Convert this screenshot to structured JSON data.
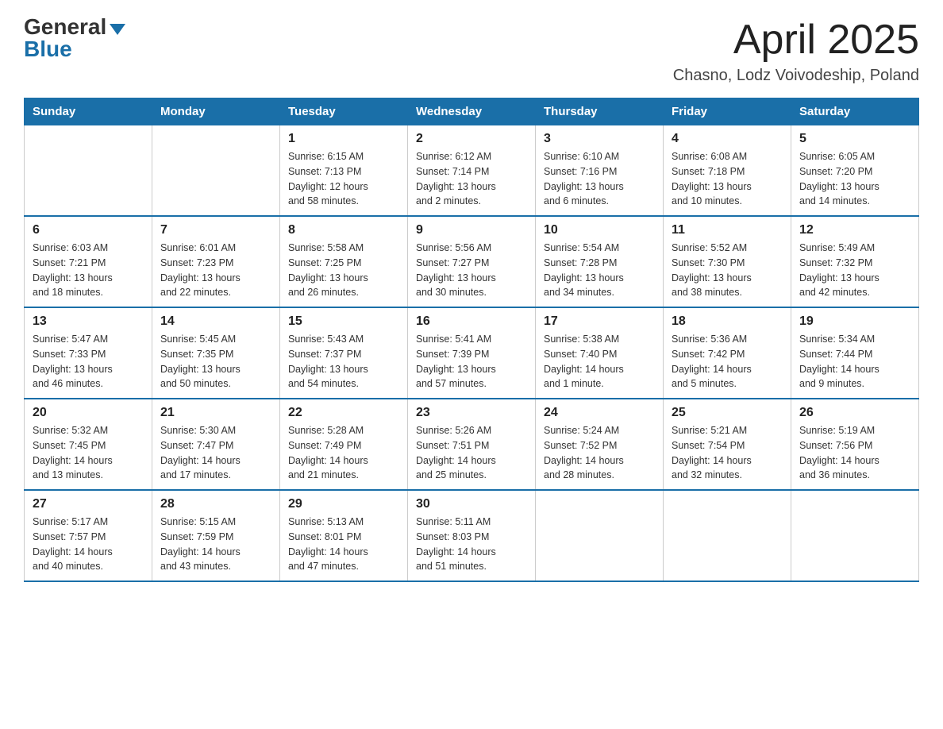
{
  "header": {
    "logo_general": "General",
    "logo_blue": "Blue",
    "month_title": "April 2025",
    "location": "Chasno, Lodz Voivodeship, Poland"
  },
  "weekdays": [
    "Sunday",
    "Monday",
    "Tuesday",
    "Wednesday",
    "Thursday",
    "Friday",
    "Saturday"
  ],
  "weeks": [
    [
      {
        "day": "",
        "info": ""
      },
      {
        "day": "",
        "info": ""
      },
      {
        "day": "1",
        "info": "Sunrise: 6:15 AM\nSunset: 7:13 PM\nDaylight: 12 hours\nand 58 minutes."
      },
      {
        "day": "2",
        "info": "Sunrise: 6:12 AM\nSunset: 7:14 PM\nDaylight: 13 hours\nand 2 minutes."
      },
      {
        "day": "3",
        "info": "Sunrise: 6:10 AM\nSunset: 7:16 PM\nDaylight: 13 hours\nand 6 minutes."
      },
      {
        "day": "4",
        "info": "Sunrise: 6:08 AM\nSunset: 7:18 PM\nDaylight: 13 hours\nand 10 minutes."
      },
      {
        "day": "5",
        "info": "Sunrise: 6:05 AM\nSunset: 7:20 PM\nDaylight: 13 hours\nand 14 minutes."
      }
    ],
    [
      {
        "day": "6",
        "info": "Sunrise: 6:03 AM\nSunset: 7:21 PM\nDaylight: 13 hours\nand 18 minutes."
      },
      {
        "day": "7",
        "info": "Sunrise: 6:01 AM\nSunset: 7:23 PM\nDaylight: 13 hours\nand 22 minutes."
      },
      {
        "day": "8",
        "info": "Sunrise: 5:58 AM\nSunset: 7:25 PM\nDaylight: 13 hours\nand 26 minutes."
      },
      {
        "day": "9",
        "info": "Sunrise: 5:56 AM\nSunset: 7:27 PM\nDaylight: 13 hours\nand 30 minutes."
      },
      {
        "day": "10",
        "info": "Sunrise: 5:54 AM\nSunset: 7:28 PM\nDaylight: 13 hours\nand 34 minutes."
      },
      {
        "day": "11",
        "info": "Sunrise: 5:52 AM\nSunset: 7:30 PM\nDaylight: 13 hours\nand 38 minutes."
      },
      {
        "day": "12",
        "info": "Sunrise: 5:49 AM\nSunset: 7:32 PM\nDaylight: 13 hours\nand 42 minutes."
      }
    ],
    [
      {
        "day": "13",
        "info": "Sunrise: 5:47 AM\nSunset: 7:33 PM\nDaylight: 13 hours\nand 46 minutes."
      },
      {
        "day": "14",
        "info": "Sunrise: 5:45 AM\nSunset: 7:35 PM\nDaylight: 13 hours\nand 50 minutes."
      },
      {
        "day": "15",
        "info": "Sunrise: 5:43 AM\nSunset: 7:37 PM\nDaylight: 13 hours\nand 54 minutes."
      },
      {
        "day": "16",
        "info": "Sunrise: 5:41 AM\nSunset: 7:39 PM\nDaylight: 13 hours\nand 57 minutes."
      },
      {
        "day": "17",
        "info": "Sunrise: 5:38 AM\nSunset: 7:40 PM\nDaylight: 14 hours\nand 1 minute."
      },
      {
        "day": "18",
        "info": "Sunrise: 5:36 AM\nSunset: 7:42 PM\nDaylight: 14 hours\nand 5 minutes."
      },
      {
        "day": "19",
        "info": "Sunrise: 5:34 AM\nSunset: 7:44 PM\nDaylight: 14 hours\nand 9 minutes."
      }
    ],
    [
      {
        "day": "20",
        "info": "Sunrise: 5:32 AM\nSunset: 7:45 PM\nDaylight: 14 hours\nand 13 minutes."
      },
      {
        "day": "21",
        "info": "Sunrise: 5:30 AM\nSunset: 7:47 PM\nDaylight: 14 hours\nand 17 minutes."
      },
      {
        "day": "22",
        "info": "Sunrise: 5:28 AM\nSunset: 7:49 PM\nDaylight: 14 hours\nand 21 minutes."
      },
      {
        "day": "23",
        "info": "Sunrise: 5:26 AM\nSunset: 7:51 PM\nDaylight: 14 hours\nand 25 minutes."
      },
      {
        "day": "24",
        "info": "Sunrise: 5:24 AM\nSunset: 7:52 PM\nDaylight: 14 hours\nand 28 minutes."
      },
      {
        "day": "25",
        "info": "Sunrise: 5:21 AM\nSunset: 7:54 PM\nDaylight: 14 hours\nand 32 minutes."
      },
      {
        "day": "26",
        "info": "Sunrise: 5:19 AM\nSunset: 7:56 PM\nDaylight: 14 hours\nand 36 minutes."
      }
    ],
    [
      {
        "day": "27",
        "info": "Sunrise: 5:17 AM\nSunset: 7:57 PM\nDaylight: 14 hours\nand 40 minutes."
      },
      {
        "day": "28",
        "info": "Sunrise: 5:15 AM\nSunset: 7:59 PM\nDaylight: 14 hours\nand 43 minutes."
      },
      {
        "day": "29",
        "info": "Sunrise: 5:13 AM\nSunset: 8:01 PM\nDaylight: 14 hours\nand 47 minutes."
      },
      {
        "day": "30",
        "info": "Sunrise: 5:11 AM\nSunset: 8:03 PM\nDaylight: 14 hours\nand 51 minutes."
      },
      {
        "day": "",
        "info": ""
      },
      {
        "day": "",
        "info": ""
      },
      {
        "day": "",
        "info": ""
      }
    ]
  ]
}
